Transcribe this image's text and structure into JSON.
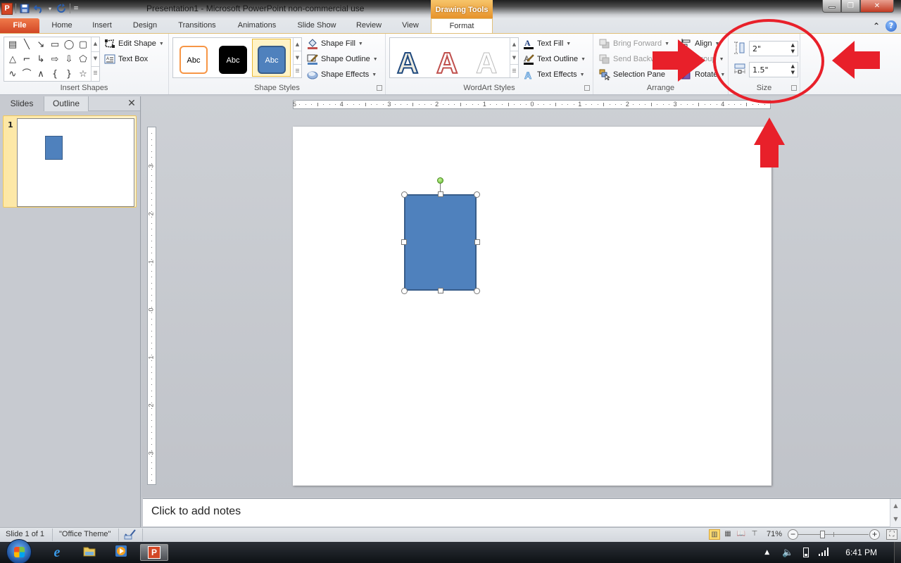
{
  "window": {
    "title": "Presentation1  -  Microsoft PowerPoint non-commercial use",
    "app_icon_letter": "P",
    "contextual_tab_group": "Drawing Tools",
    "controls": {
      "minimize": "—",
      "restore": "❐",
      "close": "✕"
    }
  },
  "quick_access": {
    "save": "💾",
    "undo": "↶",
    "redo": "↻",
    "customize": "▾"
  },
  "tabs": [
    {
      "label": "File"
    },
    {
      "label": "Home"
    },
    {
      "label": "Insert"
    },
    {
      "label": "Design"
    },
    {
      "label": "Transitions"
    },
    {
      "label": "Animations"
    },
    {
      "label": "Slide Show"
    },
    {
      "label": "Review"
    },
    {
      "label": "View"
    },
    {
      "label": "Format"
    }
  ],
  "ribbon_controls": {
    "minimize": "⌃",
    "help": "?"
  },
  "ribbon": {
    "insert_shapes": {
      "label": "Insert Shapes",
      "shapes": [
        "▤",
        "╲",
        "↘",
        "▭",
        "◯",
        "▢",
        "△",
        "⌐",
        "↳",
        "⇨",
        "⇩",
        "⬠",
        "∿",
        "⌒",
        "∧",
        "{",
        "}",
        "☆"
      ],
      "edit_shape": "Edit Shape",
      "text_box": "Text Box"
    },
    "shape_styles": {
      "label": "Shape Styles",
      "swatches": [
        {
          "text": "Abc",
          "fill": "#ffffff",
          "outline": "#f79646",
          "color": "#000000"
        },
        {
          "text": "Abc",
          "fill": "#000000",
          "outline": "#000000",
          "color": "#ffffff"
        },
        {
          "text": "Abc",
          "fill": "#4f81bd",
          "outline": "#385d8a",
          "color": "#ffffff"
        }
      ],
      "shape_fill": "Shape Fill",
      "shape_outline": "Shape Outline",
      "shape_effects": "Shape Effects"
    },
    "wordart_styles": {
      "label": "WordArt Styles",
      "letters": [
        "A",
        "A",
        "A"
      ],
      "text_fill": "Text Fill",
      "text_outline": "Text Outline",
      "text_effects": "Text Effects"
    },
    "arrange": {
      "label": "Arrange",
      "bring_forward": "Bring Forward",
      "send_backward": "Send Backward",
      "selection_pane": "Selection Pane",
      "align": "Align",
      "group": "Group",
      "rotate": "Rotate"
    },
    "size": {
      "label": "Size",
      "height_value": "2\"",
      "width_value": "1.5\""
    }
  },
  "slides_pane": {
    "tabs": [
      "Slides",
      "Outline"
    ],
    "close": "✕",
    "thumbnails": [
      {
        "number": "1"
      }
    ]
  },
  "rulers": {
    "horizontal": [
      "5",
      "4",
      "3",
      "2",
      "1",
      "0",
      "1",
      "2",
      "3",
      "4"
    ],
    "vertical": [
      "3",
      "2",
      "1",
      "0",
      "1",
      "2",
      "3"
    ]
  },
  "slide": {
    "shape": {
      "fill": "#4f81bd",
      "outline": "#385d8a",
      "height_in": 2,
      "width_in": 1.5
    }
  },
  "notes": {
    "placeholder": "Click to add notes"
  },
  "statusbar": {
    "slide_info": "Slide 1 of 1",
    "theme": "\"Office Theme\"",
    "zoom": "71%",
    "zoom_level_percent": 71,
    "zoom_minus": "−",
    "zoom_plus": "+"
  },
  "taskbar": {
    "apps": [
      "Internet Explorer",
      "Windows Explorer",
      "Windows Media Player",
      "PowerPoint"
    ],
    "clock": "6:41 PM"
  },
  "annotations": {
    "color": "#e8202a"
  }
}
